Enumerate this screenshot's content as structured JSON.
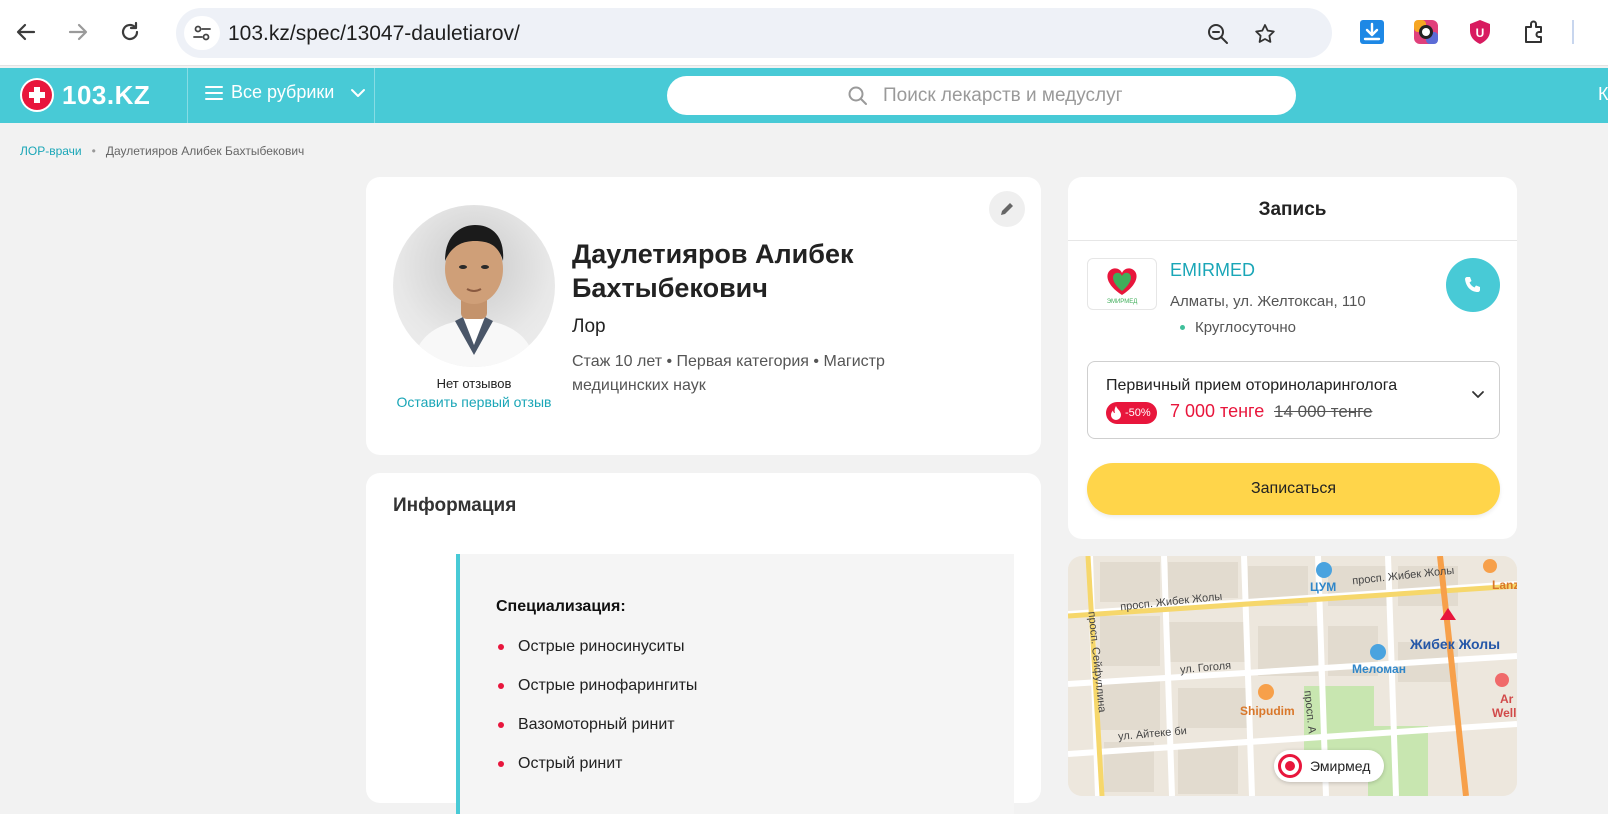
{
  "browser": {
    "url": "103.kz/spec/13047-dauletiarov/"
  },
  "header": {
    "logo_text": "103.KZ",
    "rubrics_label": "Все рубрики",
    "search_placeholder": "Поиск лекарств и медуслуг",
    "right_text": "К"
  },
  "breadcrumb": {
    "items": [
      "ЛОР-врачи",
      "Даулетияров Алибек Бахтыбекович"
    ],
    "separator": "•"
  },
  "doctor": {
    "name": "Даулетияров Алибек Бахтыбекович",
    "specialty": "Лор",
    "meta": "Стаж 10 лет  •  Первая категория • Магистр медицинских наук",
    "no_reviews": "Нет отзывов",
    "leave_review": "Оставить первый отзыв"
  },
  "info": {
    "title": "Информация",
    "spec_title": "Специализация:",
    "spec_items": [
      "Острые риносинуситы",
      "Острые ринофарингиты",
      "Вазомоторный ринит",
      "Острый ринит"
    ]
  },
  "booking": {
    "title": "Запись",
    "clinic_name": "EMIRMED",
    "clinic_address": "Алматы, ул. Желтоксан, 110",
    "clinic_hours": "Круглосуточно",
    "clinic_logo_text": "ЭМИРМЕД",
    "service_name": "Первичный прием оториноларинголога",
    "discount": "-50%",
    "price_new": "7 000 тенге",
    "price_old": "14 000 тенге",
    "book_button": "Записаться"
  },
  "map": {
    "labels": {
      "zhibek1": "просп. Жибек Жолы",
      "zhibek2": "просп. Жибек Жолы",
      "seifullin": "просп. Сейфуллина",
      "gogol": "ул. Гоголя",
      "aiteke": "ул. Айтеке би",
      "prosp": "просп. А",
      "tsum": "ЦУМ",
      "meloman": "Меломан",
      "shipudim": "Shipudim",
      "zhibek_metro": "Жибек Жолы",
      "lanzho": "Lanzho",
      "wellne": "Wellne",
      "ar": "Ar"
    },
    "pin_label": "Эмирмед"
  },
  "colors": {
    "brand": "#48cad6",
    "accent_red": "#e8163c",
    "button_yellow": "#ffd54a",
    "link": "#1aa6b7"
  }
}
